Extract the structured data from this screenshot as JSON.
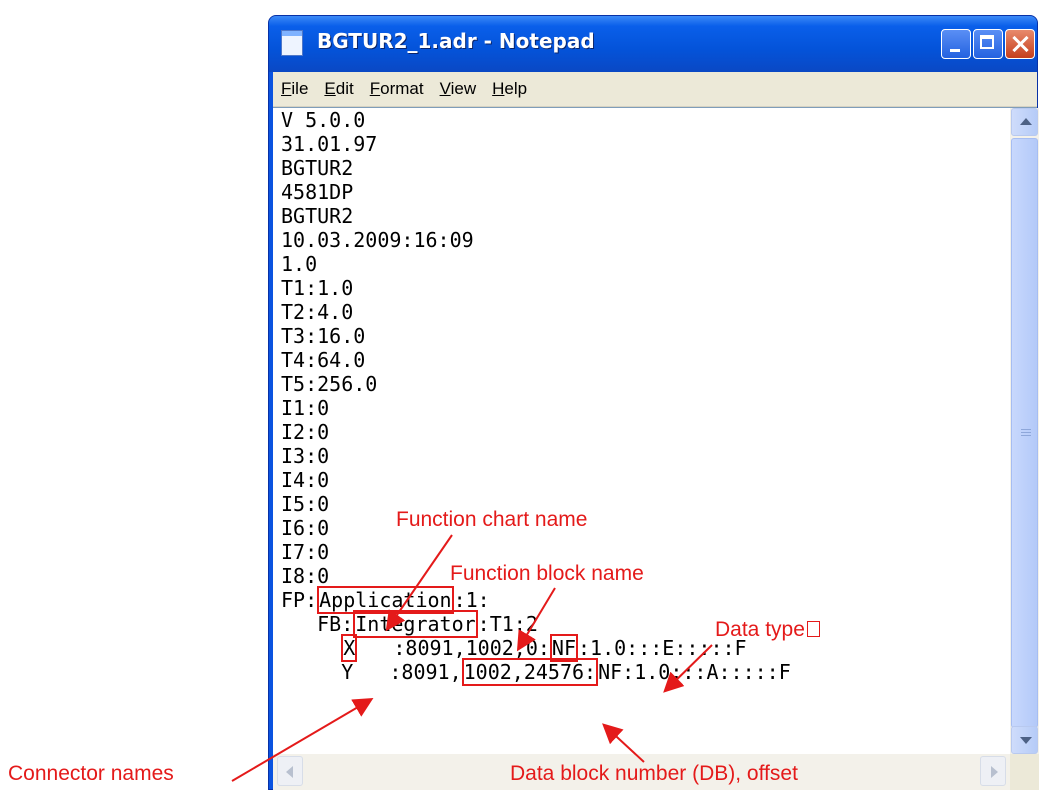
{
  "window": {
    "title": "BGTUR2_1.adr - Notepad",
    "title_color": "#0a53e0"
  },
  "menu": {
    "items": [
      "File",
      "Edit",
      "Format",
      "View",
      "Help"
    ]
  },
  "editor": {
    "lines": [
      "V 5.0.0",
      "31.01.97",
      "BGTUR2",
      "4581DP",
      "BGTUR2",
      "10.03.2009:16:09",
      "1.0",
      "T1:1.0",
      "T2:4.0",
      "T3:16.0",
      "T4:64.0",
      "T5:256.0",
      "I1:0",
      "I2:0",
      "I3:0",
      "I4:0",
      "I5:0",
      "I6:0",
      "I7:0",
      "I8:0"
    ],
    "fp_line": {
      "prefix": "FP:",
      "name": "Application",
      "suffix": ":1:"
    },
    "fb_line": {
      "prefix": "   FB:",
      "name": "Integrator",
      "suffix": ":T1:2"
    },
    "x_line": {
      "indent": "     ",
      "name": "X",
      "mid": "   :8091,1002,0:",
      "type": "NF",
      "suffix": ":1.0:::E:::::F"
    },
    "y_line": {
      "indent": "     ",
      "name": "Y",
      "mid": "   :8091,",
      "db": "1002,24576:",
      "suffix": "NF:1.0:::A:::::F"
    }
  },
  "annotations": {
    "function_chart_name": "Function chart name",
    "function_block_name": "Function block name",
    "data_type": "Data type",
    "connector_names": "Connector names",
    "data_block_number": "Data block number (DB), offset",
    "color": "#e41a1a"
  }
}
